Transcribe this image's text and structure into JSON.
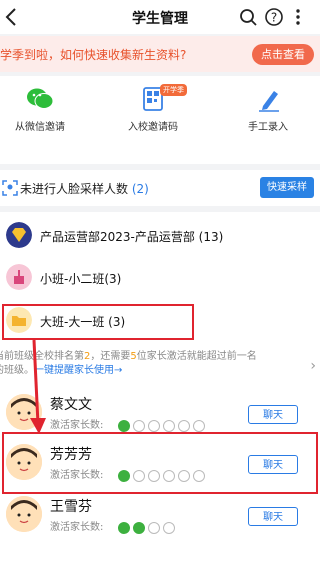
{
  "header": {
    "title": "学生管理"
  },
  "banner": {
    "text": "开学季到啦，如何快速收集新生资料?",
    "button": "点击查看"
  },
  "invite": [
    {
      "label": "从微信邀请"
    },
    {
      "label": "入校邀请码",
      "badge": "开学季"
    },
    {
      "label": "手工录入"
    }
  ],
  "face_sampling": {
    "text": "未进行人脸采样人数",
    "count": "(2)",
    "button": "快速采样"
  },
  "groups": [
    {
      "label": "产品运营部2023-产品运营部 (13)"
    },
    {
      "label": "小班-小二班(3)"
    },
    {
      "label": "大班-大一班 (3)"
    }
  ],
  "hint": {
    "line1_a": "当前班级全校排名第",
    "rank": "2",
    "line1_b": "，还需要",
    "need": "5",
    "line1_c": "位家长激活就能超过前一名",
    "line2": "的班级。",
    "link": "一键提醒家长使用→"
  },
  "students": [
    {
      "name": "蔡文文",
      "sub": "激活家长数:",
      "chat": "聊天",
      "active": 1
    },
    {
      "name": "芳芳芳",
      "sub": "激活家长数:",
      "chat": "聊天",
      "active": 1
    },
    {
      "name": "王雪芬",
      "sub": "激活家长数:",
      "chat": "聊天",
      "active": 2
    }
  ],
  "colors": {
    "accent": "#2a7be4",
    "banner_text": "#e8522c",
    "annotation_red": "#e0242f"
  }
}
